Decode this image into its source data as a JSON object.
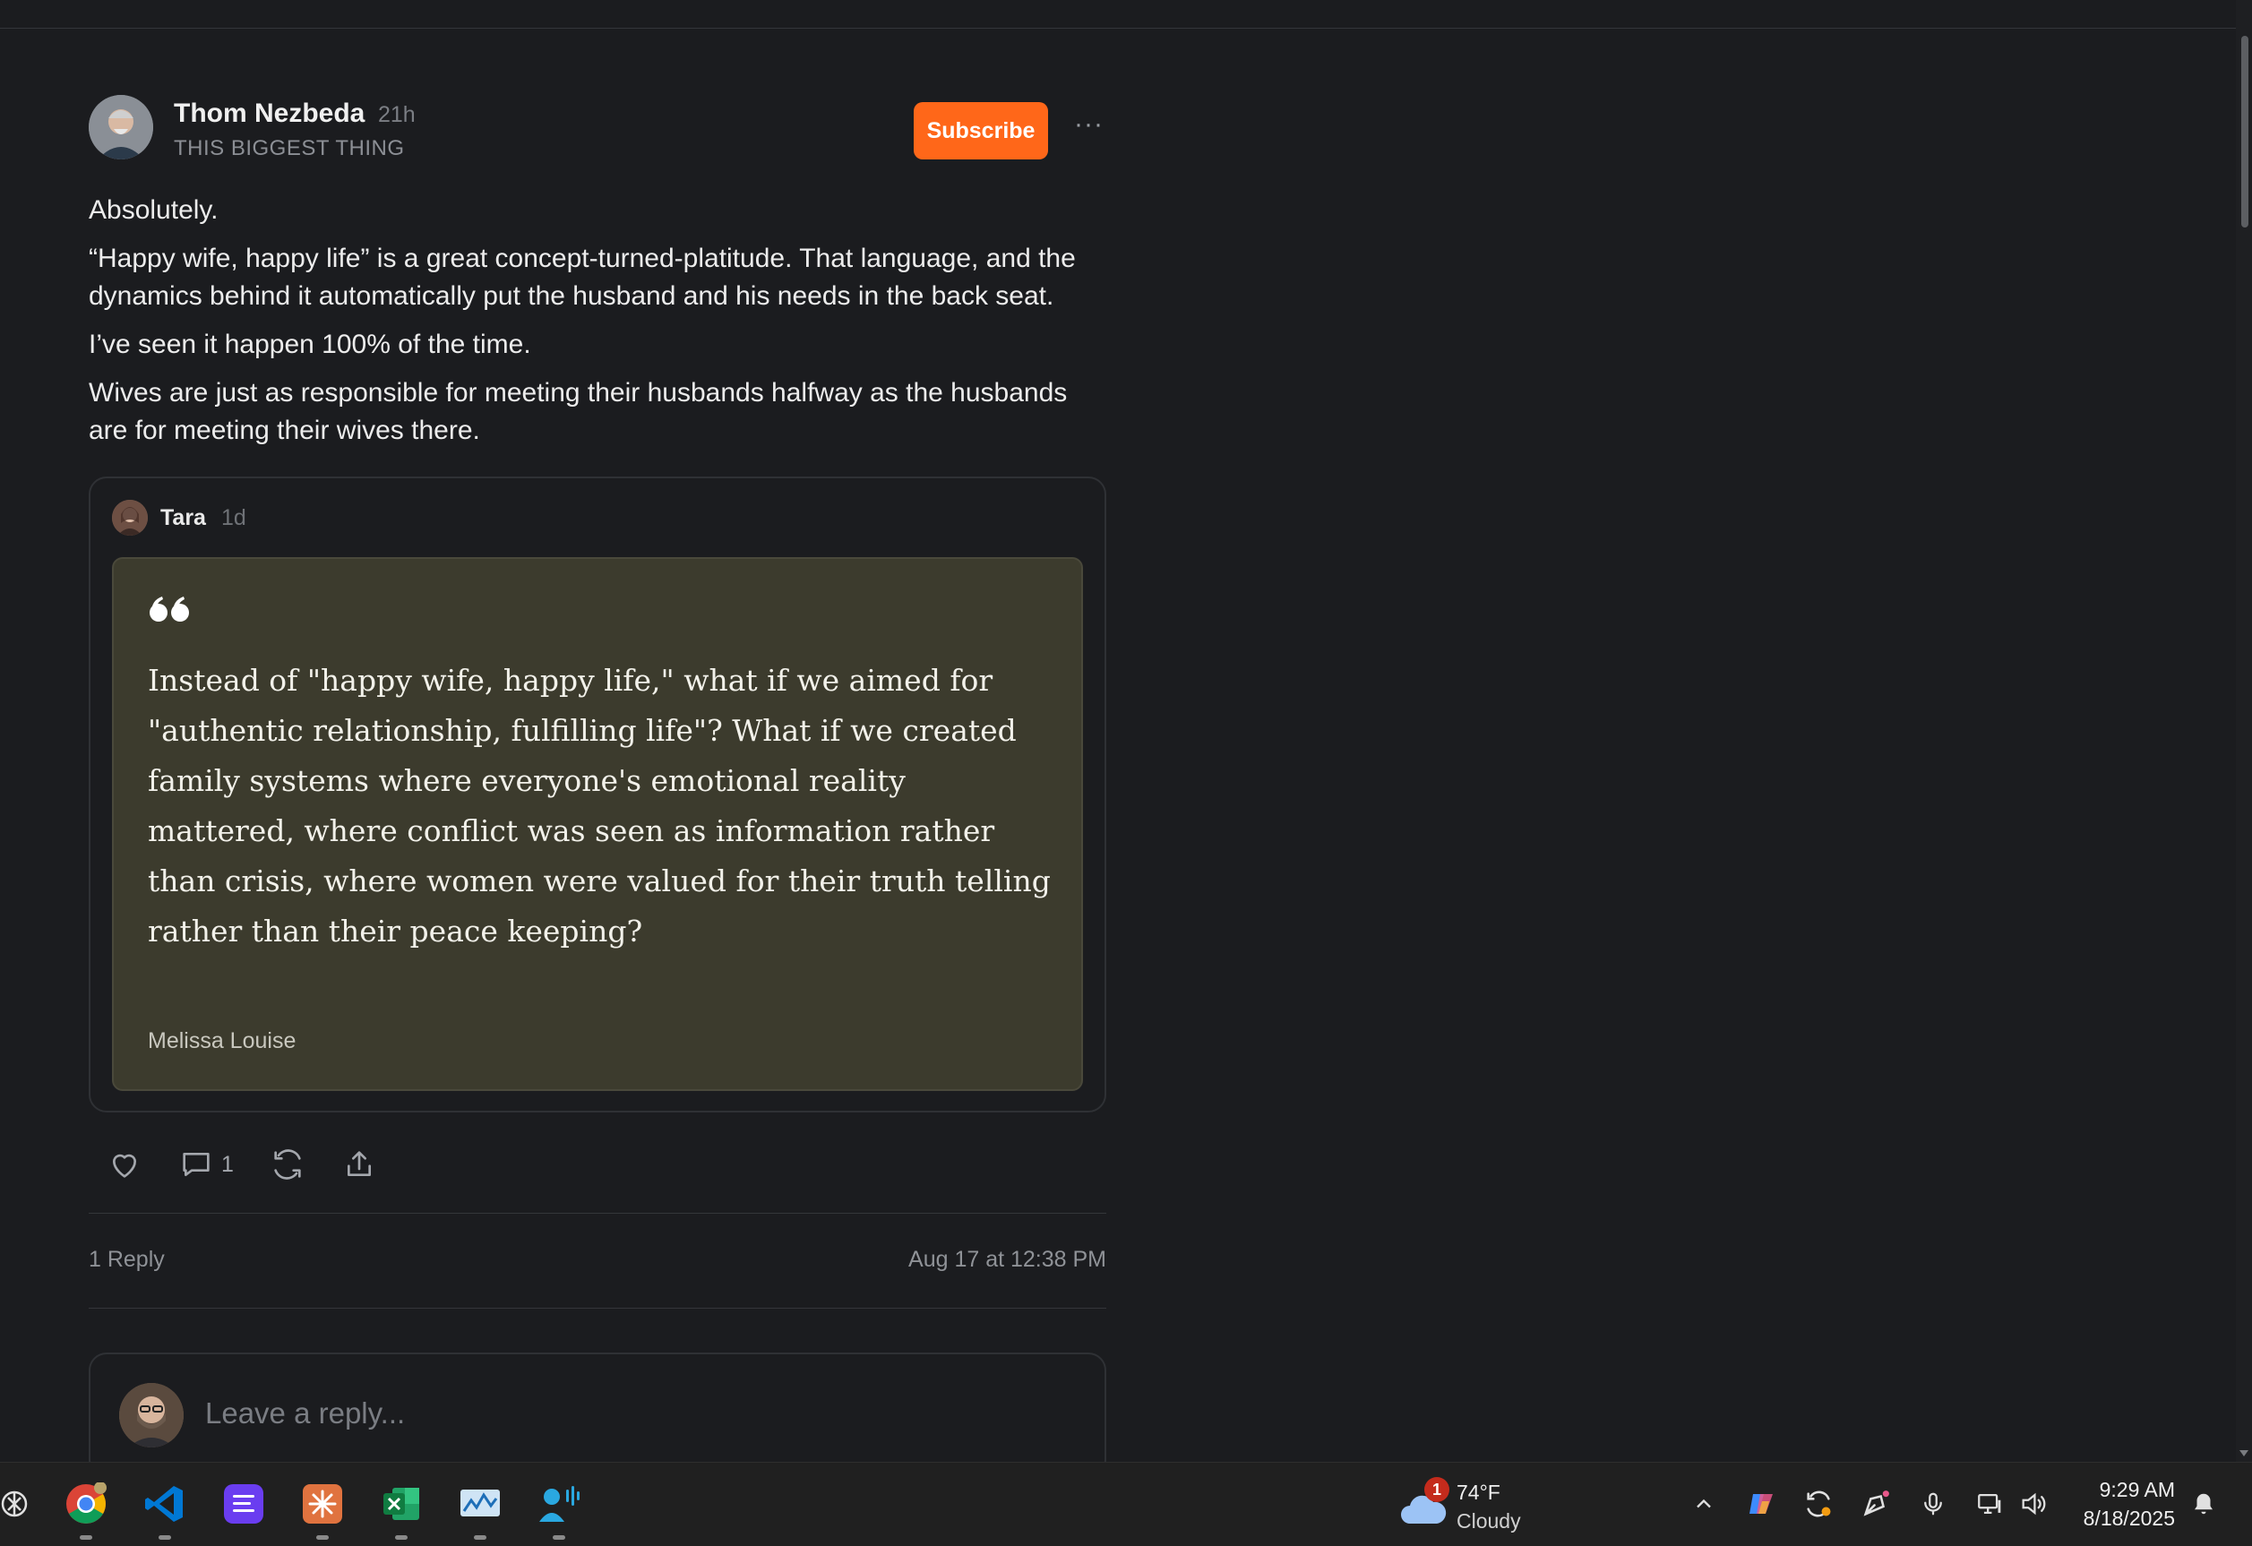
{
  "post": {
    "author": "Thom Nezbeda",
    "time": "21h",
    "publication": "THIS BIGGEST THING",
    "subscribe_label": "Subscribe",
    "more_label": "···",
    "paragraphs": [
      "Absolutely.",
      "“Happy wife, happy life” is a great concept-turned-platitude. That language, and the dynamics behind it automatically put the husband and his needs in the back seat.",
      "I’ve seen it happen 100% of the time.",
      "Wives are just as responsible for meeting their husbands halfway as the husbands are for meeting their wives there."
    ]
  },
  "quoted": {
    "author": "Tara",
    "time": "1d",
    "text": "Instead of \"happy wife, happy life,\" what if we aimed for \"authentic relationship, fulfilling life\"? What if we created family systems where everyone's emotional reality mattered, where conflict was seen as information rather than crisis, where women were valued for their truth telling rather than their peace keeping?",
    "attribution": "Melissa Louise"
  },
  "actions": {
    "like_icon": "heart-icon",
    "comment_icon": "comment-icon",
    "comment_count": "1",
    "restack_icon": "restack-icon",
    "share_icon": "share-icon"
  },
  "footer": {
    "replies": "1 Reply",
    "date": "Aug 17 at 12:38 PM"
  },
  "reply": {
    "placeholder": "Leave a reply..."
  },
  "taskbar": {
    "apps": [
      "chatgpt-icon",
      "chrome-icon",
      "vscode-icon",
      "notes-app-icon",
      "claude-icon",
      "excel-icon",
      "monitor-app-icon",
      "voice-access-icon"
    ],
    "weather_temp": "74°F",
    "weather_condition": "Cloudy",
    "weather_badge": "1",
    "clock_time": "9:29 AM",
    "clock_date": "8/18/2025"
  },
  "colors": {
    "background": "#1b1c1f",
    "accent": "#ff6719",
    "quote_bg": "#3c3b2d"
  }
}
